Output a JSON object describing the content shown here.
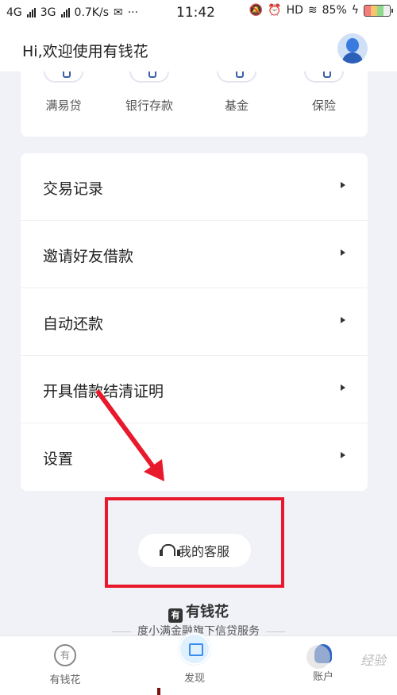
{
  "status_bar": {
    "network1": "4G",
    "network2": "3G",
    "speed": "0.7K/s",
    "more": "···",
    "time": "11:42",
    "hd": "HD",
    "battery_percent": "85%"
  },
  "header": {
    "greeting": "Hi,欢迎使用有钱花"
  },
  "quick_actions": [
    {
      "label": "满易贷",
      "icon": "loan-icon"
    },
    {
      "label": "银行存款",
      "icon": "bank-icon"
    },
    {
      "label": "基金",
      "icon": "fund-icon"
    },
    {
      "label": "保险",
      "icon": "insurance-icon"
    }
  ],
  "menu": [
    {
      "label": "交易记录"
    },
    {
      "label": "邀请好友借款"
    },
    {
      "label": "自动还款"
    },
    {
      "label": "开具借款结清证明"
    },
    {
      "label": "设置"
    }
  ],
  "service": {
    "label": "我的客服"
  },
  "brand": {
    "name": "有钱花",
    "tagline": "度小满金融旗下信贷服务"
  },
  "bottom_nav": [
    {
      "label": "有钱花"
    },
    {
      "label": "发现"
    },
    {
      "label": "账户"
    }
  ],
  "watermark": "经验",
  "colors": {
    "accent": "#2f64c2",
    "annotation": "#e8192c",
    "background": "#f0f2f7"
  }
}
